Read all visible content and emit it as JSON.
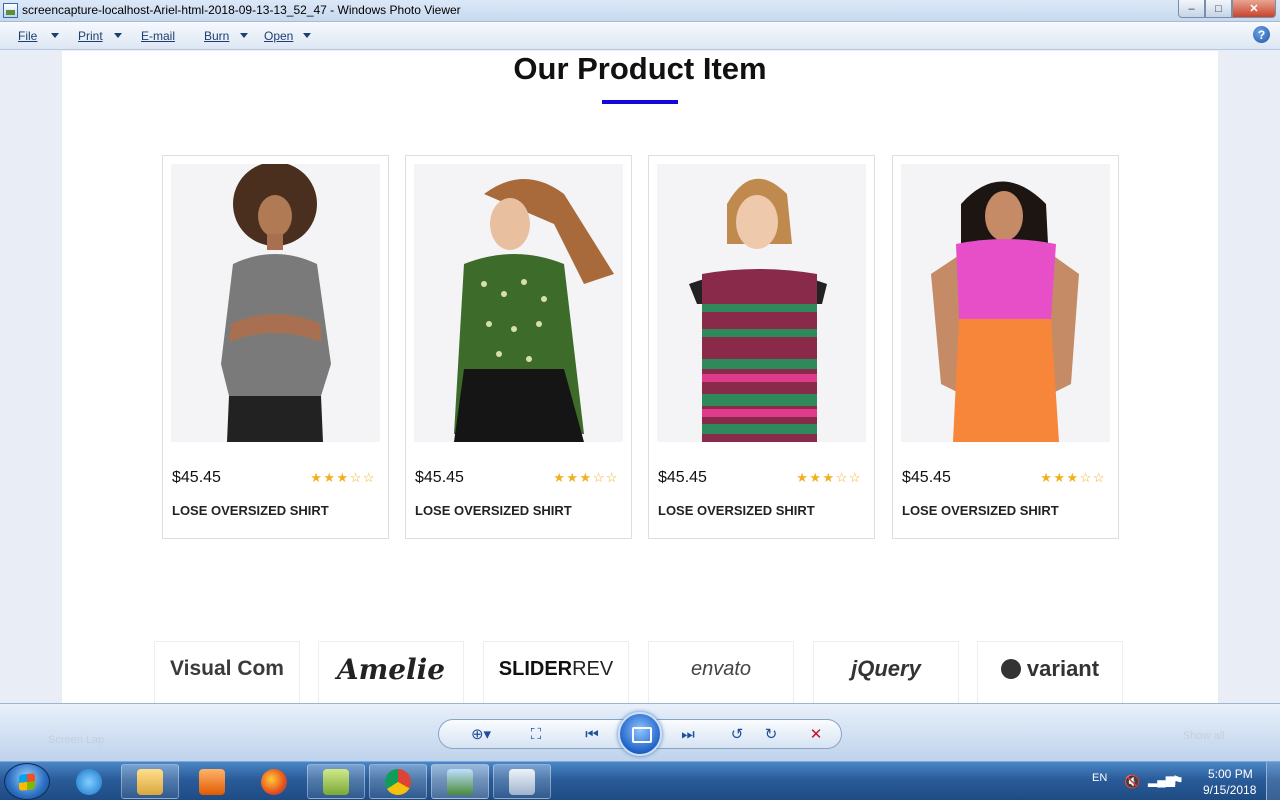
{
  "window": {
    "title": "screencapture-localhost-Ariel-html-2018-09-13-13_52_47 - Windows Photo Viewer",
    "minimize_icon": "minimize-icon",
    "maximize_icon": "maximize-icon",
    "close_icon": "close-icon"
  },
  "menu": {
    "items": [
      {
        "label": "File",
        "has_dropdown": true
      },
      {
        "label": "Print",
        "has_dropdown": true
      },
      {
        "label": "E-mail",
        "has_dropdown": false
      },
      {
        "label": "Burn",
        "has_dropdown": true
      },
      {
        "label": "Open",
        "has_dropdown": true
      }
    ],
    "help_label": "?"
  },
  "page": {
    "section_title": "Our Product Item",
    "accent_color": "#1208d8",
    "products": [
      {
        "price": "$45.45",
        "name": "LOSE OVERSIZED SHIRT",
        "rating": 3,
        "rating_max": 5,
        "outfit": "grey top, black jeans"
      },
      {
        "price": "$45.45",
        "name": "LOSE OVERSIZED SHIRT",
        "rating": 3,
        "rating_max": 5,
        "outfit": "green dotted blouse, black skirt"
      },
      {
        "price": "$45.45",
        "name": "LOSE OVERSIZED SHIRT",
        "rating": 3,
        "rating_max": 5,
        "outfit": "striped multicolor dress"
      },
      {
        "price": "$45.45",
        "name": "LOSE OVERSIZED SHIRT",
        "rating": 3,
        "rating_max": 5,
        "outfit": "pink top, orange skirt"
      }
    ],
    "brands": [
      {
        "label": "Visual Com"
      },
      {
        "label": "Amelie"
      },
      {
        "label_bold": "SLIDER",
        "label_light": " REV"
      },
      {
        "label": "envato"
      },
      {
        "label": "jQuery"
      },
      {
        "label": "variant"
      }
    ],
    "star_color": "#f2b01e"
  },
  "toolbar": {
    "buttons": [
      "zoom-icon",
      "actual-size-icon",
      "previous-icon",
      "slideshow-icon",
      "next-icon",
      "rotate-left-icon",
      "rotate-right-icon",
      "delete-icon"
    ],
    "ghost_left": "Screen Lap",
    "ghost_right": "Show all"
  },
  "taskbar": {
    "apps": [
      "windows-explorer",
      "internet-explorer",
      "file-explorer",
      "media-player",
      "firefox",
      "notepad-plus",
      "chrome",
      "photo-viewer",
      "calculator"
    ],
    "language": "EN",
    "time": "5:00 PM",
    "date": "9/15/2018"
  }
}
